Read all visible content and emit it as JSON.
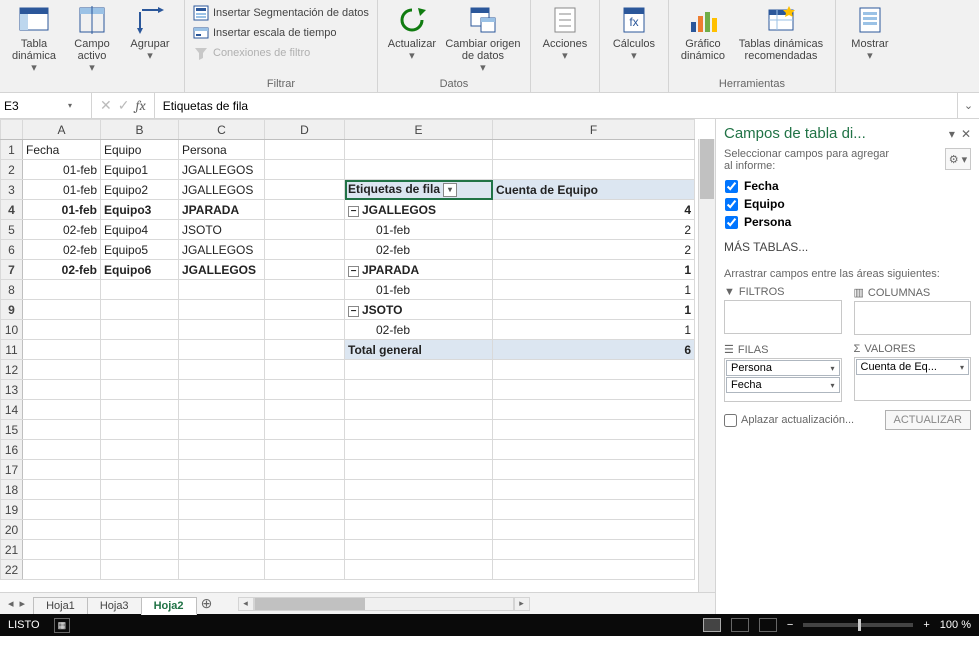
{
  "ribbon": {
    "groups": {
      "tablas": {
        "tabla": "Tabla\ndinámica",
        "campo": "Campo\nactivo",
        "agrupar": "Agrupar"
      },
      "filtrar": {
        "label": "Filtrar",
        "seg": "Insertar Segmentación de datos",
        "escala": "Insertar escala de tiempo",
        "conex": "Conexiones de filtro"
      },
      "datos": {
        "label": "Datos",
        "actualizar": "Actualizar",
        "origen": "Cambiar origen\nde datos"
      },
      "acciones": "Acciones",
      "calculos": "Cálculos",
      "herramientas": {
        "label": "Herramientas",
        "grafico": "Gráfico\ndinámico",
        "recom": "Tablas dinámicas\nrecomendadas"
      },
      "mostrar": "Mostrar"
    }
  },
  "namebox": "E3",
  "formula": "Etiquetas de fila",
  "columns": [
    "A",
    "B",
    "C",
    "D",
    "E",
    "F"
  ],
  "data_rows": [
    {
      "r": "1",
      "A": "Fecha",
      "B": "Equipo",
      "C": "Persona"
    },
    {
      "r": "2",
      "A": "01-feb",
      "B": "Equipo1",
      "C": "JGALLEGOS"
    },
    {
      "r": "3",
      "A": "01-feb",
      "B": "Equipo2",
      "C": "JGALLEGOS"
    },
    {
      "r": "4",
      "A": "01-feb",
      "B": "Equipo3",
      "C": "JPARADA"
    },
    {
      "r": "5",
      "A": "02-feb",
      "B": "Equipo4",
      "C": "JSOTO"
    },
    {
      "r": "6",
      "A": "02-feb",
      "B": "Equipo5",
      "C": "JGALLEGOS"
    },
    {
      "r": "7",
      "A": "02-feb",
      "B": "Equipo6",
      "C": "JGALLEGOS"
    }
  ],
  "pivot": {
    "hdr_rows": "Etiquetas de fila",
    "hdr_vals": "Cuenta de Equipo",
    "rows": [
      {
        "label": "JGALLEGOS",
        "val": "4",
        "grp": true
      },
      {
        "label": "01-feb",
        "val": "2",
        "indent": true
      },
      {
        "label": "02-feb",
        "val": "2",
        "indent": true
      },
      {
        "label": "JPARADA",
        "val": "1",
        "grp": true
      },
      {
        "label": "01-feb",
        "val": "1",
        "indent": true
      },
      {
        "label": "JSOTO",
        "val": "1",
        "grp": true
      },
      {
        "label": "02-feb",
        "val": "1",
        "indent": true
      }
    ],
    "total_label": "Total general",
    "total_val": "6"
  },
  "sheets": {
    "tabs": [
      "Hoja1",
      "Hoja3",
      "Hoja2"
    ],
    "active": "Hoja2"
  },
  "pane": {
    "title": "Campos de tabla di...",
    "sub": "Seleccionar campos para agregar al informe:",
    "fields": [
      "Fecha",
      "Equipo",
      "Persona"
    ],
    "mas": "MÁS TABLAS...",
    "drag": "Arrastrar campos entre las áreas siguientes:",
    "area_filtros": "FILTROS",
    "area_columnas": "COLUMNAS",
    "area_filas": "FILAS",
    "area_valores": "VALORES",
    "pill_persona": "Persona",
    "pill_fecha": "Fecha",
    "pill_cuenta": "Cuenta de Eq...",
    "defer": "Aplazar actualización...",
    "update": "ACTUALIZAR"
  },
  "status": {
    "listo": "LISTO",
    "zoom": "100 %"
  }
}
